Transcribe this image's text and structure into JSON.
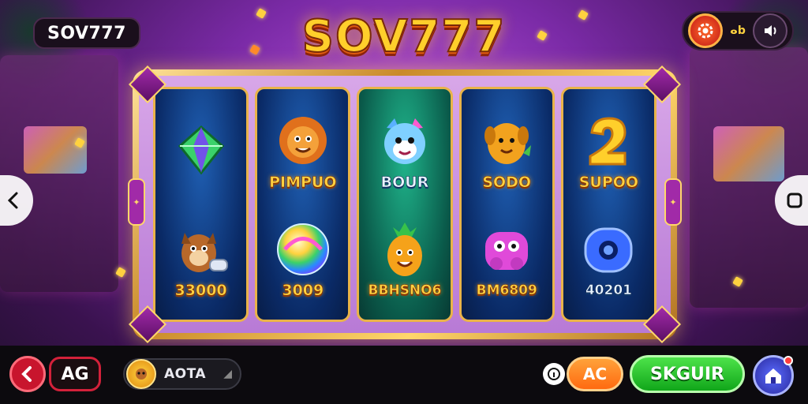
{
  "header": {
    "brand_chip": "SOV777",
    "logo_title": "SOV777",
    "toggle_label": "ⴰb"
  },
  "reels": [
    {
      "top": {
        "icon": "gem-icon",
        "label": ""
      },
      "bottom": {
        "icon": "squirrel-icon",
        "label": "33000"
      }
    },
    {
      "top": {
        "icon": "lion-icon",
        "label": "PIMPUO"
      },
      "bottom": {
        "icon": "swirl-orb-icon",
        "label": "3009"
      }
    },
    {
      "top": {
        "icon": "cat-icon",
        "label": "BOUR"
      },
      "bottom": {
        "icon": "pineapple-icon",
        "label": "BBHSNO6"
      }
    },
    {
      "top": {
        "icon": "dog-icon",
        "label": "SODO"
      },
      "bottom": {
        "icon": "pink-monster-icon",
        "label": "BM6809"
      }
    },
    {
      "top": {
        "icon": "number-two-icon",
        "label": "SUPOO"
      },
      "bottom": {
        "icon": "blue-ring-icon",
        "label": "40201"
      }
    }
  ],
  "bottom_bar": {
    "ag_label": "AG",
    "balance_label": "AOTA",
    "ac_label": "AC",
    "spin_label": "SKGUIR"
  },
  "colors": {
    "logo_gold": "#ffcf2b",
    "spin_green": "#11a61a",
    "ac_orange": "#ff6a10",
    "back_red": "#c8152d"
  }
}
